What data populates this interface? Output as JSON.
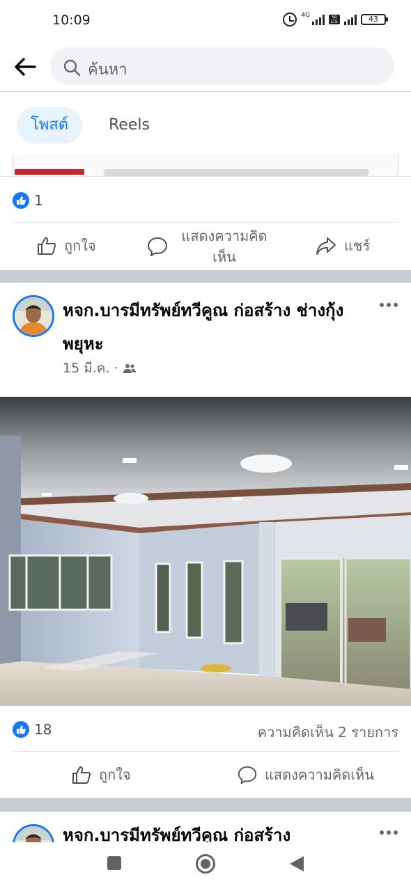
{
  "status_bar": {
    "time": "10:09",
    "network_label": "4G",
    "volte_label": "Vo LTE",
    "battery": "43"
  },
  "search": {
    "placeholder": "ค้นหา"
  },
  "tabs": [
    {
      "label": "โพสต์",
      "selected": true
    },
    {
      "label": "Reels",
      "selected": false
    }
  ],
  "previous_post": {
    "like_count": "1",
    "actions": {
      "like": "ถูกใจ",
      "comment": "แสดงความคิดเห็น",
      "share": "แชร์"
    }
  },
  "post": {
    "author": "หจก.บารมีทรัพย์ทวีคูณ ก่อสร้าง ช่างกุ้งพยุหะ",
    "date": "15 มี.ค.",
    "separator": "·",
    "audience_icon": "friends-icon",
    "like_count": "18",
    "comment_count": "ความคิดเห็น 2 รายการ",
    "actions": {
      "like": "ถูกใจ",
      "comment": "แสดงความคิดเห็น"
    }
  },
  "next_post": {
    "author": "หจก.บารมีทรัพย์ทวีคูณ ก่อสร้าง"
  },
  "colors": {
    "accent": "#1877f2",
    "tab_selected_bg": "#e7f3ff",
    "divider": "#c9ccd1",
    "secondary_text": "#65676b"
  },
  "nav": [
    "recents-icon",
    "home-icon",
    "back-icon"
  ]
}
